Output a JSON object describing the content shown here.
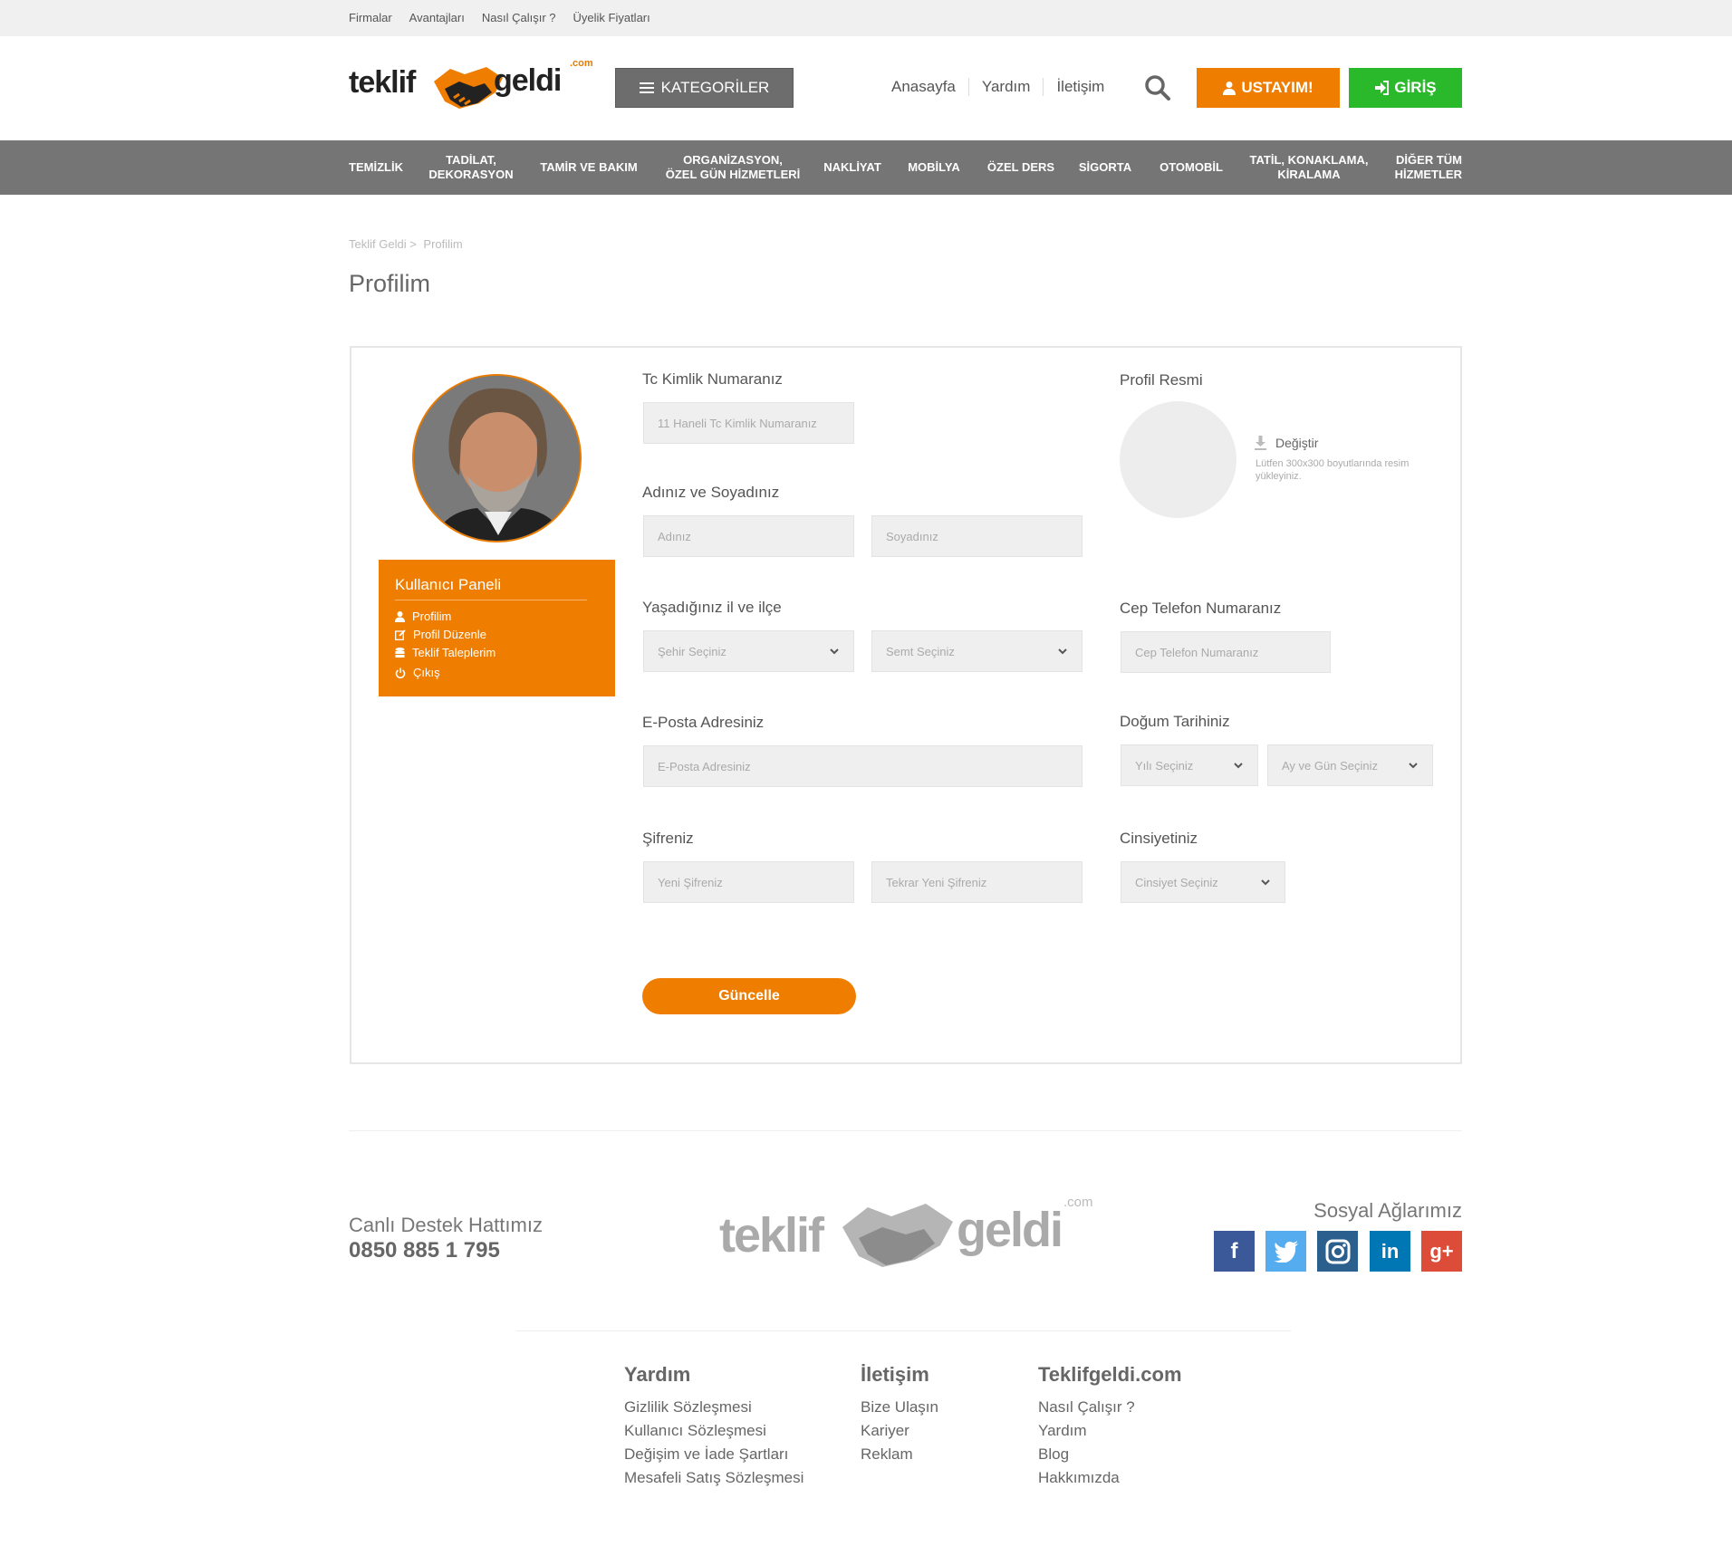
{
  "topbar": {
    "links": [
      "Firmalar",
      "Avantajları",
      "Nasıl Çalışır ?",
      "Üyelik Fiyatları"
    ]
  },
  "header": {
    "logo": {
      "word1": "teklif",
      "word2": "geldi",
      "suffix": ".com"
    },
    "categories_button": "KATEGORİLER",
    "nav": [
      "Anasayfa",
      "Yardım",
      "İletişim"
    ],
    "usta_button": "USTAYIM!",
    "login_button": "GİRİŞ"
  },
  "categories": [
    "TEMİZLİK",
    "TADİLAT,\nDEKORASYON",
    "TAMİR VE BAKIM",
    "ORGANİZASYON,\nÖZEL GÜN HİZMETLERİ",
    "NAKLİYAT",
    "MOBİLYA",
    "ÖZEL DERS",
    "SİGORTA",
    "OTOMOBİL",
    "TATİL, KONAKLAMA,\nKİRALAMA",
    "DİĞER TÜM\nHİZMETLER"
  ],
  "breadcrumb": {
    "home": "Teklif Geldi >",
    "current": "Profilim"
  },
  "page_title": "Profilim",
  "panel": {
    "title": "Kullanıcı Paneli",
    "items": [
      "Profilim",
      "Profil Düzenle",
      "Teklif Taleplerim",
      "Çıkış"
    ]
  },
  "form": {
    "tc": {
      "label": "Tc Kimlik Numaranız",
      "placeholder": "11 Haneli Tc Kimlik Numaranız"
    },
    "name": {
      "label": "Adınız ve Soyadınız",
      "first": "Adınız",
      "last": "Soyadınız"
    },
    "city": {
      "label": "Yaşadığınız il ve ilçe",
      "city": "Şehir Seçiniz",
      "district": "Semt Seçiniz"
    },
    "email": {
      "label": "E-Posta Adresiniz",
      "placeholder": "E-Posta Adresiniz"
    },
    "password": {
      "label": "Şifreniz",
      "new": "Yeni Şifreniz",
      "repeat": "Tekrar Yeni Şifreniz"
    },
    "photo": {
      "label": "Profil Resmi",
      "change": "Değiştir",
      "hint": "Lütfen 300x300 boyutlarında resim yükleyiniz."
    },
    "phone": {
      "label": "Cep Telefon Numaranız",
      "placeholder": "Cep Telefon Numaranız"
    },
    "birth": {
      "label": "Doğum Tarihiniz",
      "year": "Yılı Seçiniz",
      "day": "Ay ve Gün Seçiniz"
    },
    "gender": {
      "label": "Cinsiyetiniz",
      "placeholder": "Cinsiyet Seçiniz"
    },
    "submit": "Güncelle"
  },
  "footer": {
    "support_label": "Canlı Destek Hattımız",
    "support_phone": "0850 885 1 795",
    "social_title": "Sosyal Ağlarımız",
    "columns": [
      {
        "title": "Yardım",
        "links": [
          "Gizlilik Sözleşmesi",
          "Kullanıcı Sözleşmesi",
          "Değişim ve İade Şartları",
          "Mesafeli Satış Sözleşmesi"
        ]
      },
      {
        "title": "İletişim",
        "links": [
          "Bize Ulaşın",
          "Kariyer",
          "Reklam"
        ]
      },
      {
        "title": "Teklifgeldi.com",
        "links": [
          "Nasıl Çalışır ?",
          "Yardım",
          "Blog",
          "Hakkımızda"
        ]
      }
    ]
  },
  "colors": {
    "orange": "#ee7d00",
    "green": "#2ab92b",
    "gray_bar": "#757575"
  }
}
